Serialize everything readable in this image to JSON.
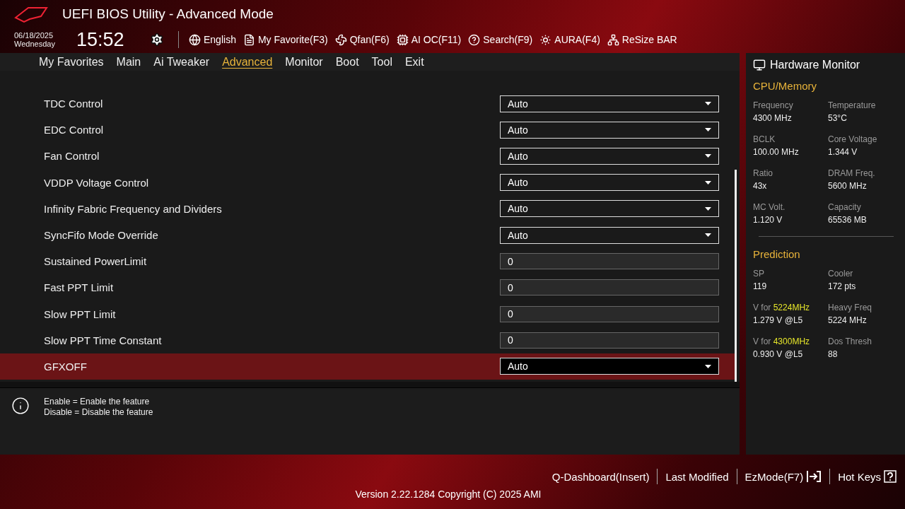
{
  "window": {
    "title": "UEFI BIOS Utility - Advanced Mode"
  },
  "header": {
    "date": "06/18/2025",
    "day": "Wednesday",
    "time": "15:52",
    "tools": [
      "English",
      "My Favorite(F3)",
      "Qfan(F6)",
      "AI OC(F11)",
      "Search(F9)",
      "AURA(F4)",
      "ReSize BAR"
    ]
  },
  "tabs": [
    {
      "label": "My Favorites",
      "selected": false
    },
    {
      "label": "Main",
      "selected": false
    },
    {
      "label": "Ai Tweaker",
      "selected": false
    },
    {
      "label": "Advanced",
      "selected": true
    },
    {
      "label": "Monitor",
      "selected": false
    },
    {
      "label": "Boot",
      "selected": false
    },
    {
      "label": "Tool",
      "selected": false
    },
    {
      "label": "Exit",
      "selected": false
    }
  ],
  "settings": [
    {
      "label": "TDC Control",
      "kind": "dropdown",
      "value": "Auto",
      "selected": false
    },
    {
      "label": "EDC Control",
      "kind": "dropdown",
      "value": "Auto",
      "selected": false
    },
    {
      "label": "Fan Control",
      "kind": "dropdown",
      "value": "Auto",
      "selected": false
    },
    {
      "label": "VDDP Voltage Control",
      "kind": "dropdown",
      "value": "Auto",
      "selected": false
    },
    {
      "label": "Infinity Fabric Frequency and Dividers",
      "kind": "dropdown",
      "value": "Auto",
      "selected": false
    },
    {
      "label": "SyncFifo Mode Override",
      "kind": "dropdown",
      "value": "Auto",
      "selected": false
    },
    {
      "label": "Sustained PowerLimit",
      "kind": "number",
      "value": "0",
      "selected": false
    },
    {
      "label": "Fast PPT Limit",
      "kind": "number",
      "value": "0",
      "selected": false
    },
    {
      "label": "Slow PPT Limit",
      "kind": "number",
      "value": "0",
      "selected": false
    },
    {
      "label": "Slow PPT Time Constant",
      "kind": "number",
      "value": "0",
      "selected": false
    },
    {
      "label": "GFXOFF",
      "kind": "dropdown",
      "value": "Auto",
      "selected": true
    }
  ],
  "help": [
    "Enable = Enable the feature",
    "Disable = Disable the feature"
  ],
  "hardware_monitor": {
    "title": "Hardware Monitor",
    "sections": [
      {
        "title": "CPU/Memory",
        "items": [
          {
            "label": "Frequency",
            "value": "4300 MHz"
          },
          {
            "label": "Temperature",
            "value": "53°C"
          },
          {
            "label": "BCLK",
            "value": "100.00 MHz"
          },
          {
            "label": "Core Voltage",
            "value": "1.344 V"
          },
          {
            "label": "Ratio",
            "value": "43x"
          },
          {
            "label": "DRAM Freq.",
            "value": "5600 MHz"
          },
          {
            "label": "MC Volt.",
            "value": "1.120 V"
          },
          {
            "label": "Capacity",
            "value": "65536 MB"
          }
        ]
      },
      {
        "title": "Prediction",
        "items": [
          {
            "label": "SP",
            "value": "119"
          },
          {
            "label": "Cooler",
            "value": "172 pts"
          },
          {
            "label": "V for",
            "highlight": "5224MHz",
            "value": "1.279 V @L5"
          },
          {
            "label": "Heavy Freq",
            "value": "5224 MHz"
          },
          {
            "label": "V for",
            "highlight": "4300MHz",
            "value": "0.930 V @L5"
          },
          {
            "label": "Dos Thresh",
            "value": "88"
          }
        ]
      }
    ]
  },
  "footer": {
    "links": [
      "Q-Dashboard(Insert)",
      "Last Modified",
      "EzMode(F7)",
      "Hot Keys"
    ],
    "version": "Version 2.22.1284 Copyright (C) 2025 AMI"
  }
}
